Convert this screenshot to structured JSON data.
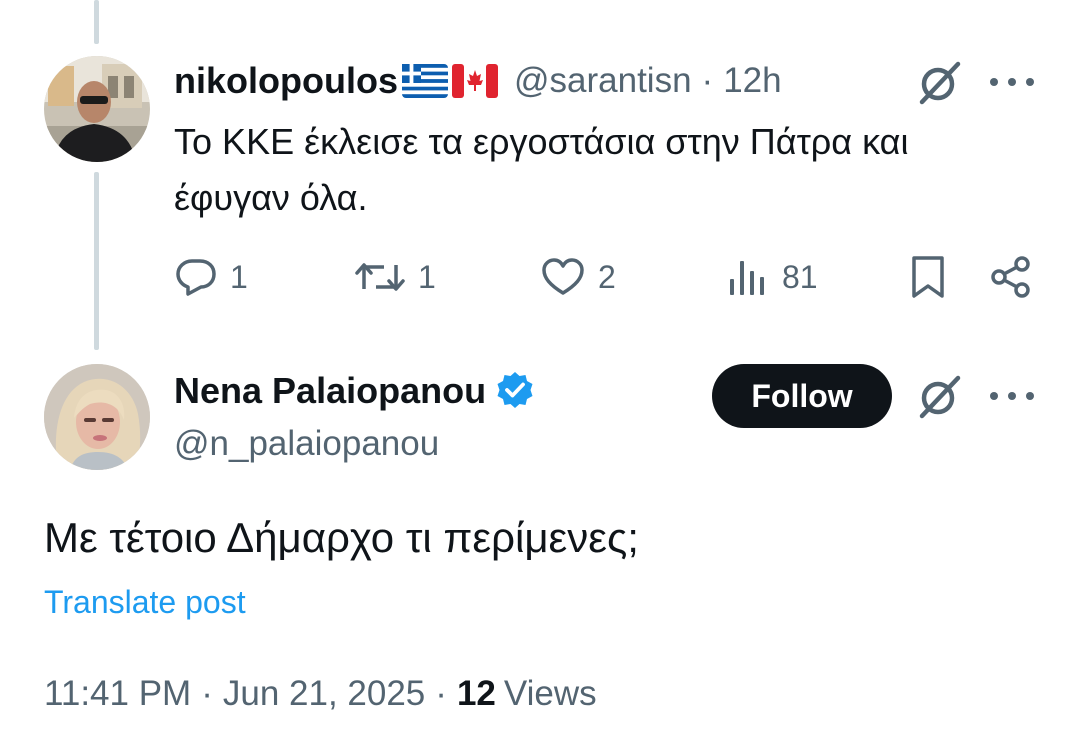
{
  "reply": {
    "display_name": "nikolopoulos",
    "flags": [
      "greece-flag-icon",
      "canada-flag-icon"
    ],
    "handle": "@sarantisn",
    "separator": "·",
    "time": "12h",
    "text": "Το ΚΚΕ έκλεισε τα εργοστάσια στην Πάτρα και έφυγαν όλα.",
    "actions": {
      "replies": "1",
      "reposts": "1",
      "likes": "2",
      "views": "81"
    }
  },
  "main_post": {
    "display_name": "Nena Palaiopanou",
    "verified": true,
    "handle": "@n_palaiopanou",
    "follow_label": "Follow",
    "text": "Με τέτοιο Δήμαρχο τι περίμενες;",
    "translate_label": "Translate post",
    "time": "11:41 PM",
    "separator": "·",
    "date": "Jun 21, 2025",
    "views_count": "12",
    "views_label": "Views"
  },
  "colors": {
    "text_primary": "#0f1419",
    "text_secondary": "#536471",
    "link_blue": "#1d9bf0",
    "thread_line": "#cfd9de",
    "follow_bg": "#0f1419"
  }
}
